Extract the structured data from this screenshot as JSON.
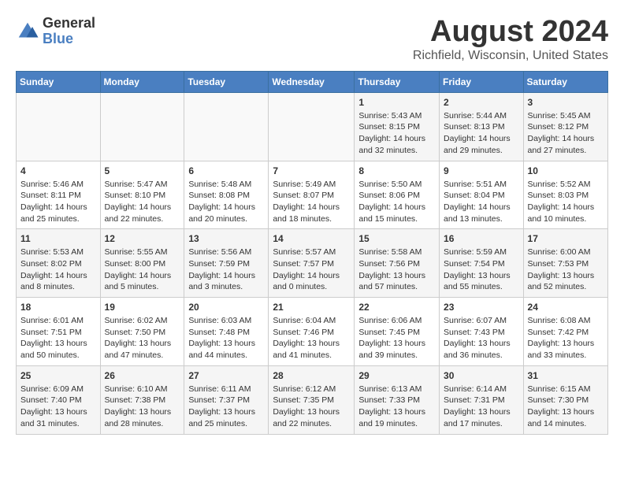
{
  "header": {
    "logo_general": "General",
    "logo_blue": "Blue",
    "month_title": "August 2024",
    "location": "Richfield, Wisconsin, United States"
  },
  "weekdays": [
    "Sunday",
    "Monday",
    "Tuesday",
    "Wednesday",
    "Thursday",
    "Friday",
    "Saturday"
  ],
  "weeks": [
    [
      {
        "day": "",
        "info": ""
      },
      {
        "day": "",
        "info": ""
      },
      {
        "day": "",
        "info": ""
      },
      {
        "day": "",
        "info": ""
      },
      {
        "day": "1",
        "info": "Sunrise: 5:43 AM\nSunset: 8:15 PM\nDaylight: 14 hours\nand 32 minutes."
      },
      {
        "day": "2",
        "info": "Sunrise: 5:44 AM\nSunset: 8:13 PM\nDaylight: 14 hours\nand 29 minutes."
      },
      {
        "day": "3",
        "info": "Sunrise: 5:45 AM\nSunset: 8:12 PM\nDaylight: 14 hours\nand 27 minutes."
      }
    ],
    [
      {
        "day": "4",
        "info": "Sunrise: 5:46 AM\nSunset: 8:11 PM\nDaylight: 14 hours\nand 25 minutes."
      },
      {
        "day": "5",
        "info": "Sunrise: 5:47 AM\nSunset: 8:10 PM\nDaylight: 14 hours\nand 22 minutes."
      },
      {
        "day": "6",
        "info": "Sunrise: 5:48 AM\nSunset: 8:08 PM\nDaylight: 14 hours\nand 20 minutes."
      },
      {
        "day": "7",
        "info": "Sunrise: 5:49 AM\nSunset: 8:07 PM\nDaylight: 14 hours\nand 18 minutes."
      },
      {
        "day": "8",
        "info": "Sunrise: 5:50 AM\nSunset: 8:06 PM\nDaylight: 14 hours\nand 15 minutes."
      },
      {
        "day": "9",
        "info": "Sunrise: 5:51 AM\nSunset: 8:04 PM\nDaylight: 14 hours\nand 13 minutes."
      },
      {
        "day": "10",
        "info": "Sunrise: 5:52 AM\nSunset: 8:03 PM\nDaylight: 14 hours\nand 10 minutes."
      }
    ],
    [
      {
        "day": "11",
        "info": "Sunrise: 5:53 AM\nSunset: 8:02 PM\nDaylight: 14 hours\nand 8 minutes."
      },
      {
        "day": "12",
        "info": "Sunrise: 5:55 AM\nSunset: 8:00 PM\nDaylight: 14 hours\nand 5 minutes."
      },
      {
        "day": "13",
        "info": "Sunrise: 5:56 AM\nSunset: 7:59 PM\nDaylight: 14 hours\nand 3 minutes."
      },
      {
        "day": "14",
        "info": "Sunrise: 5:57 AM\nSunset: 7:57 PM\nDaylight: 14 hours\nand 0 minutes."
      },
      {
        "day": "15",
        "info": "Sunrise: 5:58 AM\nSunset: 7:56 PM\nDaylight: 13 hours\nand 57 minutes."
      },
      {
        "day": "16",
        "info": "Sunrise: 5:59 AM\nSunset: 7:54 PM\nDaylight: 13 hours\nand 55 minutes."
      },
      {
        "day": "17",
        "info": "Sunrise: 6:00 AM\nSunset: 7:53 PM\nDaylight: 13 hours\nand 52 minutes."
      }
    ],
    [
      {
        "day": "18",
        "info": "Sunrise: 6:01 AM\nSunset: 7:51 PM\nDaylight: 13 hours\nand 50 minutes."
      },
      {
        "day": "19",
        "info": "Sunrise: 6:02 AM\nSunset: 7:50 PM\nDaylight: 13 hours\nand 47 minutes."
      },
      {
        "day": "20",
        "info": "Sunrise: 6:03 AM\nSunset: 7:48 PM\nDaylight: 13 hours\nand 44 minutes."
      },
      {
        "day": "21",
        "info": "Sunrise: 6:04 AM\nSunset: 7:46 PM\nDaylight: 13 hours\nand 41 minutes."
      },
      {
        "day": "22",
        "info": "Sunrise: 6:06 AM\nSunset: 7:45 PM\nDaylight: 13 hours\nand 39 minutes."
      },
      {
        "day": "23",
        "info": "Sunrise: 6:07 AM\nSunset: 7:43 PM\nDaylight: 13 hours\nand 36 minutes."
      },
      {
        "day": "24",
        "info": "Sunrise: 6:08 AM\nSunset: 7:42 PM\nDaylight: 13 hours\nand 33 minutes."
      }
    ],
    [
      {
        "day": "25",
        "info": "Sunrise: 6:09 AM\nSunset: 7:40 PM\nDaylight: 13 hours\nand 31 minutes."
      },
      {
        "day": "26",
        "info": "Sunrise: 6:10 AM\nSunset: 7:38 PM\nDaylight: 13 hours\nand 28 minutes."
      },
      {
        "day": "27",
        "info": "Sunrise: 6:11 AM\nSunset: 7:37 PM\nDaylight: 13 hours\nand 25 minutes."
      },
      {
        "day": "28",
        "info": "Sunrise: 6:12 AM\nSunset: 7:35 PM\nDaylight: 13 hours\nand 22 minutes."
      },
      {
        "day": "29",
        "info": "Sunrise: 6:13 AM\nSunset: 7:33 PM\nDaylight: 13 hours\nand 19 minutes."
      },
      {
        "day": "30",
        "info": "Sunrise: 6:14 AM\nSunset: 7:31 PM\nDaylight: 13 hours\nand 17 minutes."
      },
      {
        "day": "31",
        "info": "Sunrise: 6:15 AM\nSunset: 7:30 PM\nDaylight: 13 hours\nand 14 minutes."
      }
    ]
  ]
}
